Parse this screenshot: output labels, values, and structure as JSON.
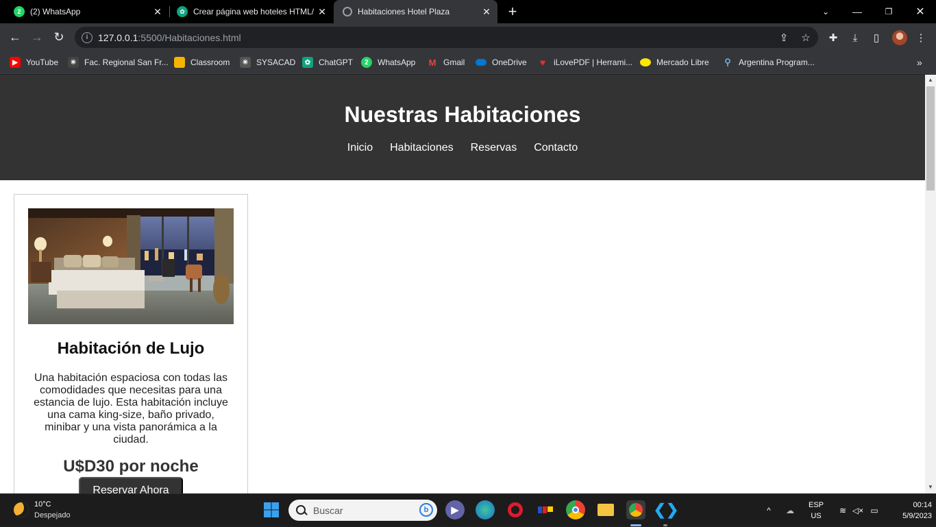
{
  "browser": {
    "tabs": [
      {
        "title": "(2) WhatsApp",
        "icon": "whatsapp-icon",
        "active": false
      },
      {
        "title": "Crear página web hoteles HTML/",
        "icon": "chatgpt-icon",
        "active": false
      },
      {
        "title": "Habitaciones Hotel Plaza",
        "icon": "globe-icon",
        "active": true
      }
    ],
    "new_tab_label": "+",
    "url_host": "127.0.0.1",
    "url_rest": ":5500/Habitaciones.html",
    "bookmarks": [
      {
        "label": "YouTube",
        "icon": "youtube-icon",
        "color": "#ff0000"
      },
      {
        "label": "Fac. Regional San Fr...",
        "icon": "utn-icon",
        "color": "#444444"
      },
      {
        "label": "Classroom",
        "icon": "classroom-icon",
        "color": "#f4b400"
      },
      {
        "label": "SYSACAD",
        "icon": "sysacad-icon",
        "color": "#555555"
      },
      {
        "label": "ChatGPT",
        "icon": "chatgpt-icon",
        "color": "#10a37f"
      },
      {
        "label": "WhatsApp",
        "icon": "whatsapp-icon",
        "color": "#25d366"
      },
      {
        "label": "Gmail",
        "icon": "gmail-icon",
        "color": "#ea4335"
      },
      {
        "label": "OneDrive",
        "icon": "onedrive-icon",
        "color": "#0078d4"
      },
      {
        "label": "iLovePDF | Herrami...",
        "icon": "ilovepdf-icon",
        "color": "#e5322d"
      },
      {
        "label": "Mercado Libre",
        "icon": "mercadolibre-icon",
        "color": "#ffe600"
      },
      {
        "label": "Argentina Program...",
        "icon": "argentina-program-icon",
        "color": "#74acdf"
      }
    ],
    "bookmarks_overflow": "»"
  },
  "page": {
    "title": "Nuestras Habitaciones",
    "nav": [
      "Inicio",
      "Habitaciones",
      "Reservas",
      "Contacto"
    ],
    "room": {
      "name": "Habitación de Lujo",
      "description": "Una habitación espaciosa con todas las comodidades que necesitas para una estancia de lujo. Esta habitación incluye una cama king-size, baño privado, minibar y una vista panorámica a la ciudad.",
      "price": "U$D30 por noche",
      "button": "Reservar Ahora"
    }
  },
  "taskbar": {
    "weather_temp": "10°C",
    "weather_desc": "Despejado",
    "search_placeholder": "Buscar",
    "lang_1": "ESP",
    "lang_2": "US",
    "time": "00:14",
    "date": "5/9/2023"
  }
}
